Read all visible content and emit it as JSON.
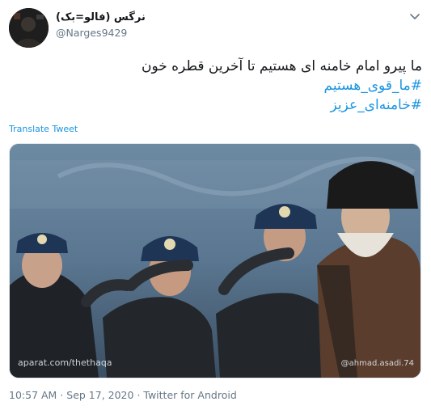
{
  "tweet": {
    "display_name": "نرگس (فالو=بک)",
    "handle": "@Narges9429",
    "text_line1": "ما پیرو امام خامنه ای هستیم تا آخرین قطره خون",
    "hashtag1": "#ما_قوی_هستیم",
    "hashtag2": "#خامنه‌ای_عزیز",
    "translate_label": "Translate Tweet",
    "time": "10:57 AM",
    "date": "Sep 17, 2020",
    "source": "Twitter for Android",
    "separator": " · "
  },
  "media": {
    "watermark_left": "aparat.com/thethaqa",
    "watermark_right": "@ahmad.asadi.74"
  },
  "colors": {
    "link": "#1b95e0",
    "secondary_text": "#657786",
    "primary_text": "#14171a"
  },
  "icons": {
    "menu": "chevron-down-icon"
  }
}
